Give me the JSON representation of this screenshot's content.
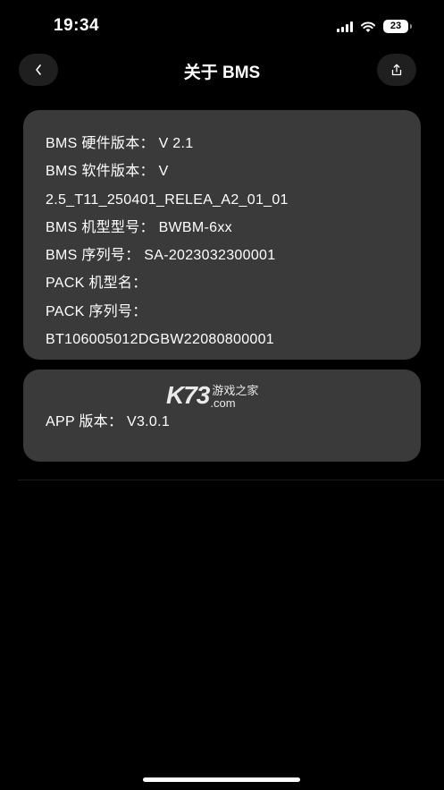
{
  "status": {
    "time": "19:34",
    "battery": "23"
  },
  "nav": {
    "title": "关于 BMS",
    "back_icon": "chevron-left-icon",
    "share_icon": "share-icon"
  },
  "info": {
    "lines": [
      "BMS 硬件版本： V 2.1",
      "BMS 软件版本： V",
      "2.5_T11_250401_RELEA_A2_01_01",
      "BMS 机型型号： BWBM-6xx",
      "BMS 序列号： SA-2023032300001",
      "PACK 机型名：",
      "PACK 序列号：",
      "BT106005012DGBW22080800001"
    ]
  },
  "app": {
    "version_line": "APP 版本： V3.0.1"
  },
  "watermark": {
    "big": "K73",
    "cn": "游戏之家",
    "domain": ".com"
  },
  "colors": {
    "background": "#000000",
    "card": "#3a3a3a",
    "button": "#1f1f1f",
    "text": "#ffffff"
  }
}
